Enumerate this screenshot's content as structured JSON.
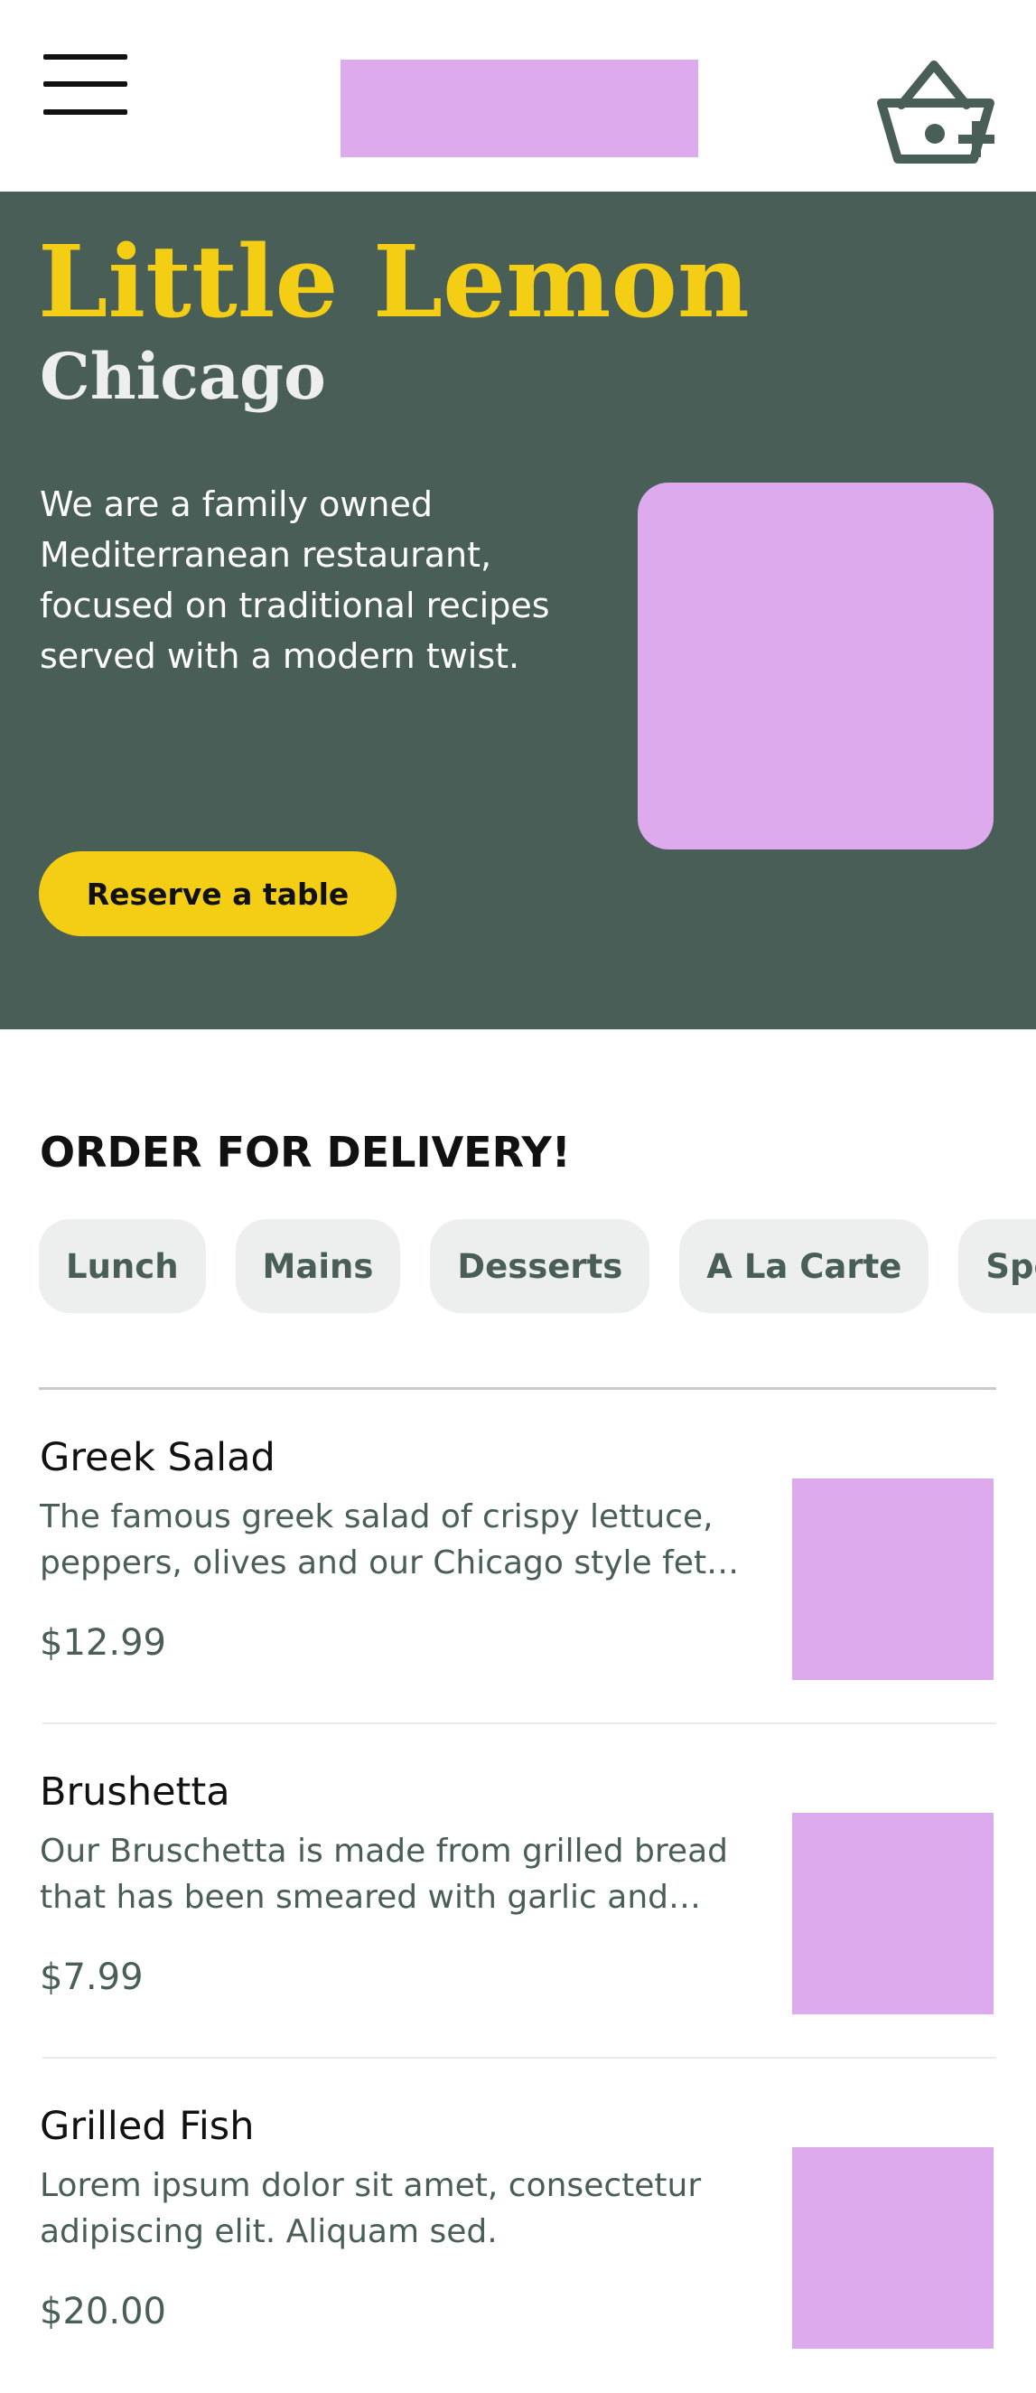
{
  "header": {
    "menu_icon": "hamburger-menu-icon",
    "logo": "logo-placeholder",
    "cart_icon": "basket-add-icon"
  },
  "hero": {
    "title": "Little Lemon",
    "subtitle": "Chicago",
    "description": "We are a family owned Mediterranean restaurant, focused on traditional recipes served with a modern twist.",
    "cta_label": "Reserve a table"
  },
  "order": {
    "title": "ORDER FOR DELIVERY!",
    "categories": [
      {
        "label": "Lunch"
      },
      {
        "label": "Mains"
      },
      {
        "label": "Desserts"
      },
      {
        "label": "A La Carte"
      },
      {
        "label": "Specials"
      }
    ]
  },
  "menu": {
    "items": [
      {
        "name": "Greek Salad",
        "description": "The famous greek salad of crispy lettuce, peppers, olives and our Chicago style feta cheese, garnished with crunchy garlic and rosemary croutons.",
        "price": "$12.99"
      },
      {
        "name": "Brushetta",
        "description": "Our Bruschetta is made from grilled bread that has been smeared with garlic and seasoned with salt and olive oil.",
        "price": "$7.99"
      },
      {
        "name": "Grilled Fish",
        "description": "Lorem ipsum dolor sit amet, consectetur adipiscing elit. Aliquam sed.",
        "price": "$20.00"
      }
    ]
  },
  "colors": {
    "primary_green": "#495e57",
    "primary_yellow": "#f4ce14",
    "chip_background": "#edefee",
    "image_placeholder": "#ddaaee"
  }
}
